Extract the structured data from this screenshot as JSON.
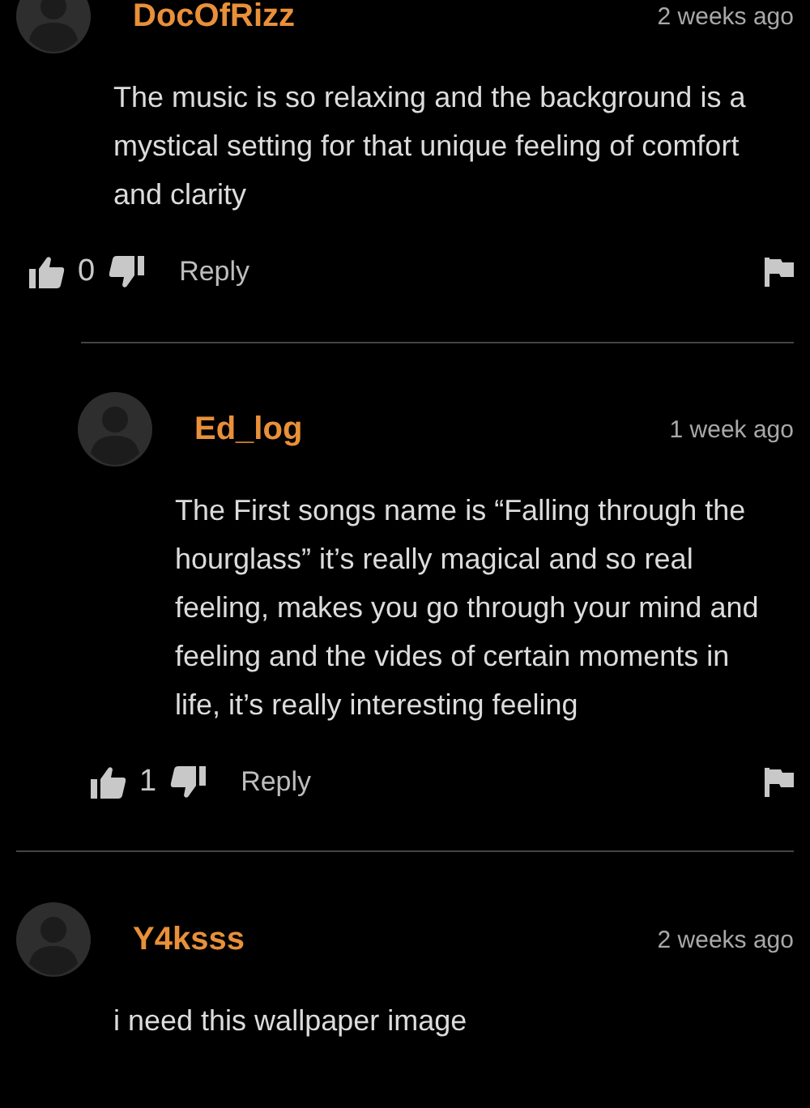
{
  "comments": [
    {
      "author": "DocOfRizz",
      "time": "2 weeks ago",
      "body": "The music is so relaxing and the background is a mystical setting for that unique feeling of comfort and clarity",
      "likes": "0",
      "reply_label": "Reply",
      "children": [
        {
          "author": "Ed_log",
          "time": "1 week ago",
          "body": "The First songs name is “Falling through the hourglass” it’s really magical and so real feeling, makes you go through your mind and feeling and the vides of certain moments in life, it’s really interesting feeling",
          "likes": "1",
          "reply_label": "Reply"
        }
      ]
    },
    {
      "author": "Y4ksss",
      "time": "2 weeks ago",
      "body": "i need this wallpaper image"
    }
  ]
}
